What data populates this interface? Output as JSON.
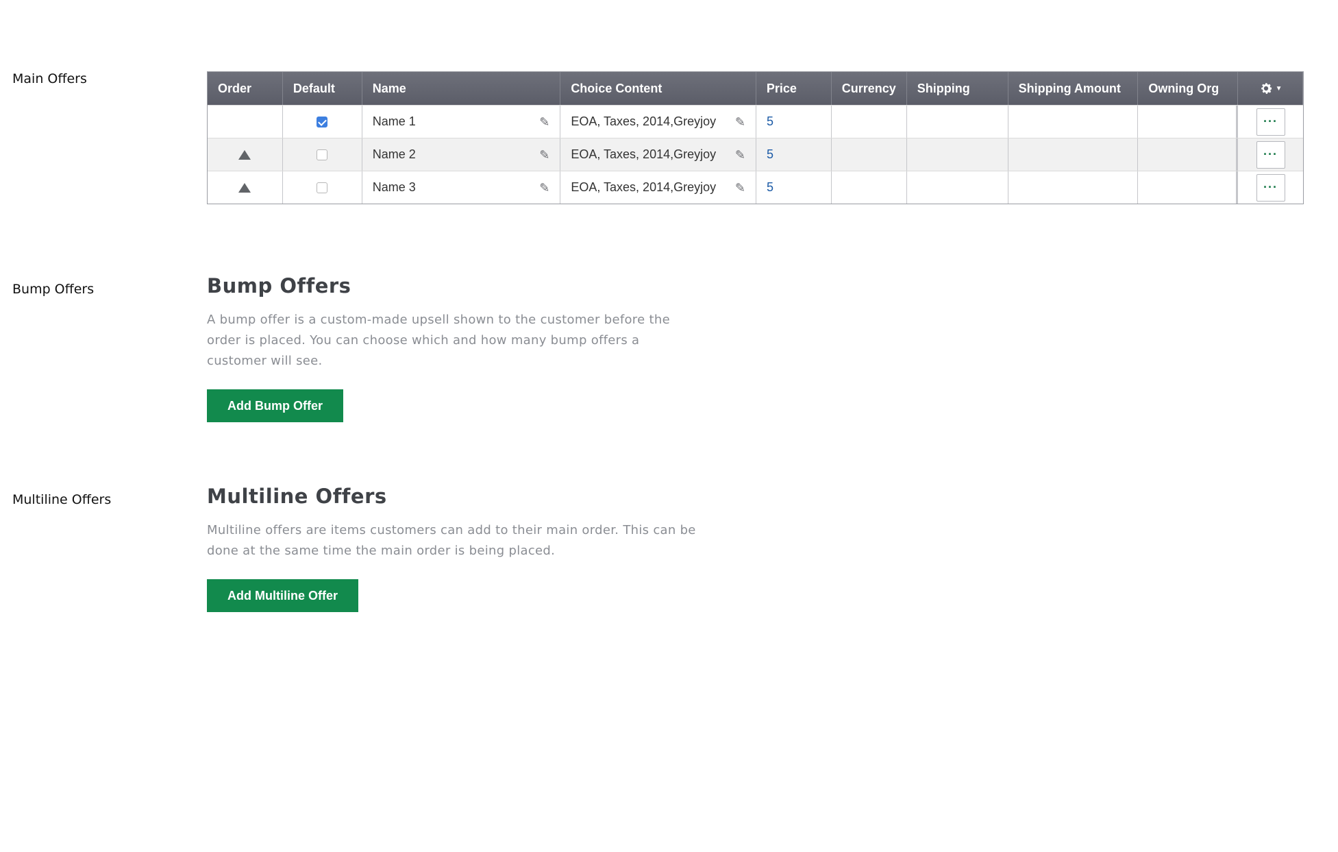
{
  "sections": {
    "main_label": "Main Offers",
    "bump_label": "Bump Offers",
    "multiline_label": "Multiline Offers"
  },
  "table": {
    "headers": {
      "order": "Order",
      "default": "Default",
      "name": "Name",
      "choice_content": "Choice Content",
      "price": "Price",
      "currency": "Currency",
      "shipping": "Shipping",
      "shipping_amount": "Shipping Amount",
      "owning_org": "Owning Org"
    },
    "settings_icon": "gear-icon",
    "rows": [
      {
        "name": "Name 1",
        "choice": "EOA, Taxes, 2014,Greyjoy",
        "price": "5",
        "default": true
      },
      {
        "name": "Name 2",
        "choice": "EOA, Taxes, 2014,Greyjoy",
        "price": "5",
        "default": false
      },
      {
        "name": "Name 3",
        "choice": "EOA, Taxes, 2014,Greyjoy",
        "price": "5",
        "default": false
      }
    ],
    "more_label": "···"
  },
  "bump": {
    "title": "Bump Offers",
    "description": "A bump offer is a custom-made upsell shown to the customer before the order is placed. You can choose which and how many bump offers a customer will see.",
    "button": "Add Bump Offer"
  },
  "multiline": {
    "title": "Multiline Offers",
    "description": "Multiline offers are items customers can add to their main order. This can be done at the same time the main order is being placed.",
    "button": "Add Multiline Offer"
  },
  "colors": {
    "accent_green": "#128a4d",
    "header_gray": "#5b5d68",
    "link_blue": "#1b5aa6"
  }
}
